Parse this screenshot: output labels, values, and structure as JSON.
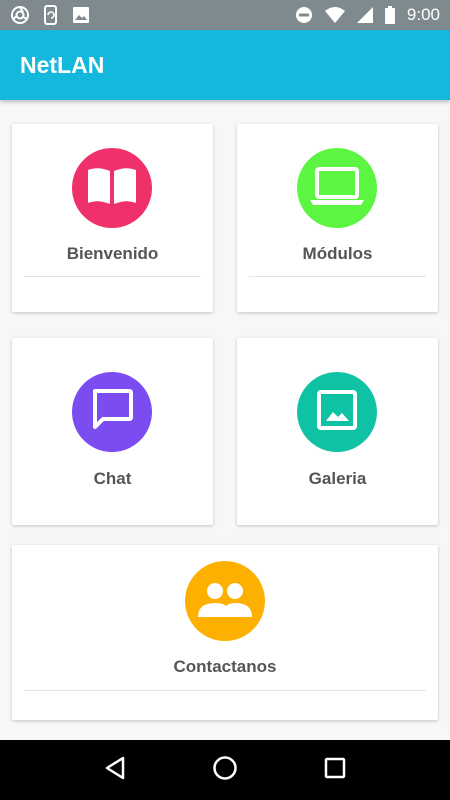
{
  "status_bar": {
    "time": "9:00",
    "left_icons": [
      "chromium-icon",
      "phone-sync-icon",
      "image-icon"
    ],
    "right_icons": [
      "do-not-disturb-icon",
      "wifi-icon",
      "signal-icon",
      "battery-icon"
    ]
  },
  "app_bar": {
    "title": "NetLAN",
    "color": "#13b8dc"
  },
  "cards": [
    {
      "id": "bienvenido",
      "label": "Bienvenido",
      "icon": "book-icon",
      "color": "#f0306b"
    },
    {
      "id": "modulos",
      "label": "Módulos",
      "icon": "laptop-icon",
      "color": "#5cf542"
    },
    {
      "id": "chat",
      "label": "Chat",
      "icon": "chat-icon",
      "color": "#7b4df0"
    },
    {
      "id": "galeria",
      "label": "Galeria",
      "icon": "gallery-icon",
      "color": "#10c2a4"
    },
    {
      "id": "contactanos",
      "label": "Contactanos",
      "icon": "people-icon",
      "color": "#fdb000"
    }
  ],
  "nav_bar": {
    "buttons": [
      "back-icon",
      "home-icon",
      "recents-icon"
    ]
  }
}
